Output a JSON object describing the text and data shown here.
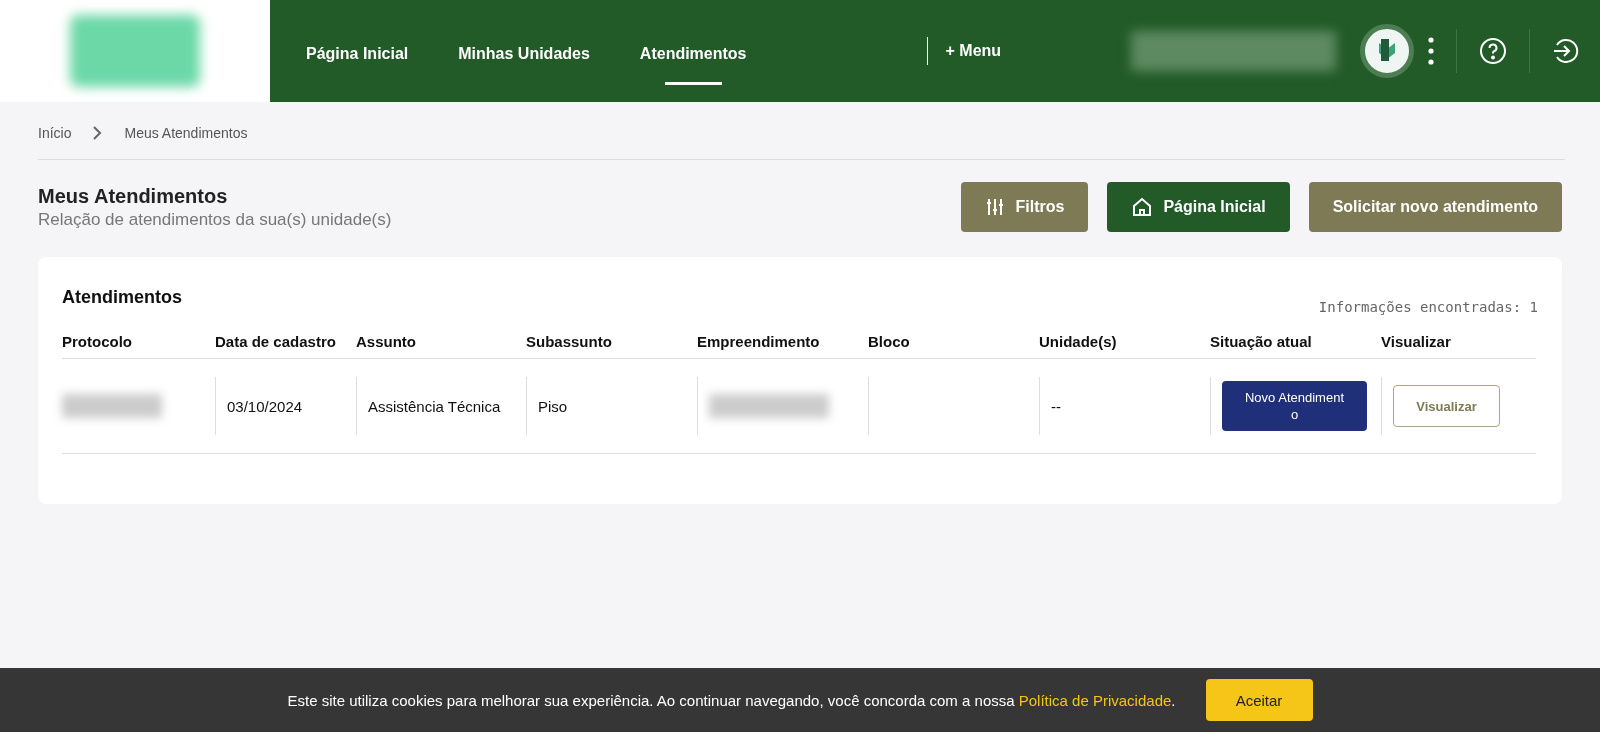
{
  "nav": {
    "items": [
      {
        "label": "Página Inicial",
        "selected": false
      },
      {
        "label": "Minhas Unidades",
        "selected": false
      },
      {
        "label": "Atendimentos",
        "selected": true
      }
    ],
    "menu": "+ Menu"
  },
  "breadcrumb": [
    "Início",
    "Meus Atendimentos"
  ],
  "page": {
    "title": "Meus Atendimentos",
    "subtitle": "Relação de atendimentos da sua(s) unidade(s)"
  },
  "actions": [
    {
      "label": "Filtros",
      "kind": "filter"
    },
    {
      "label": "Página Inicial",
      "kind": "home"
    },
    {
      "label": "Solicitar novo atendimento",
      "kind": "plain"
    }
  ],
  "table": {
    "title": "Atendimentos",
    "count": "Informações encontradas: 1",
    "columns": [
      "Protocolo",
      "Data de cadastro",
      "Assunto",
      "Subassunto",
      "Empreendimento",
      "Bloco",
      "Unidade(s)",
      "Situação atual",
      "Visualizar"
    ],
    "rows": [
      {
        "data": "03/10/2024",
        "assunto": "Assistência Técnica",
        "subassunto": "Piso",
        "unidades": "--",
        "situacao": "Novo Atendimento",
        "action": "Visualizar"
      }
    ]
  },
  "cookie": {
    "text": "Este site utiliza cookies para melhorar sua experiência. Ao continuar navegando, você concorda com a nossa ",
    "link": "Política de Privacidade",
    "end": ".",
    "button": "Aceitar"
  }
}
